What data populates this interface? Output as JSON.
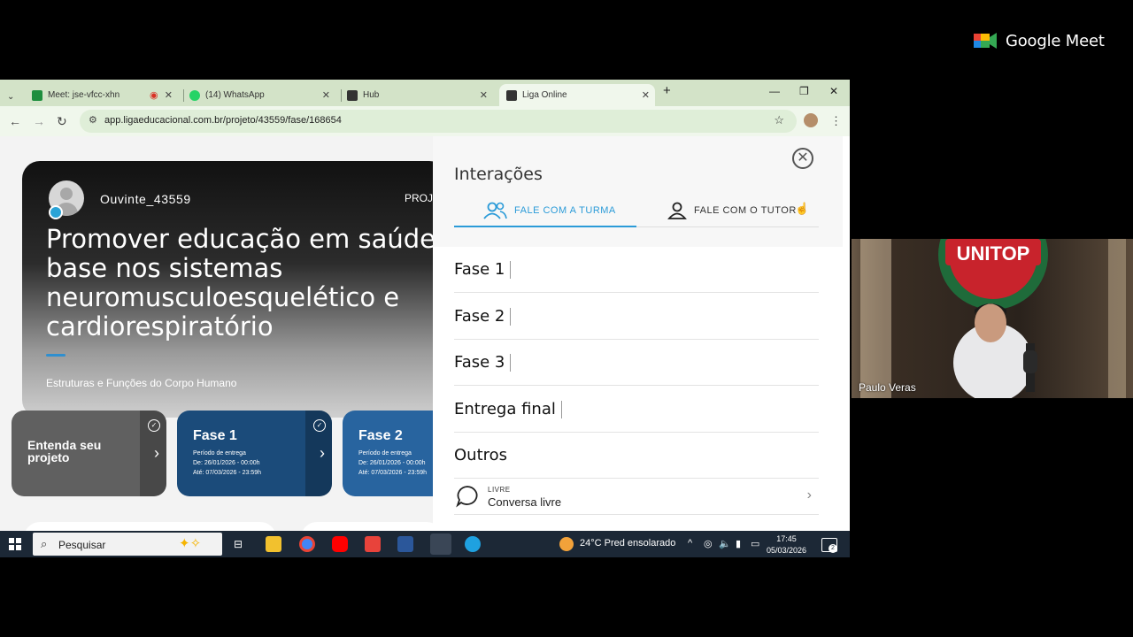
{
  "meet": {
    "brand": "Google Meet",
    "presenter_name": "Paulo Veras",
    "presenter_banner": "UNITOP"
  },
  "browser": {
    "tabs": [
      {
        "label": "Meet: jse-vfcc-xhn"
      },
      {
        "label": "(14) WhatsApp"
      },
      {
        "label": "Hub"
      },
      {
        "label": "Liga Online"
      }
    ],
    "url": "app.ligaeducacional.com.br/projeto/43559/fase/168654"
  },
  "page": {
    "user_name": "Ouvinte_43559",
    "proj_label": "PROJ",
    "title": "Promover educação em saúde base nos sistemas neuromusculoesquelético e cardiorespiratório",
    "subtitle": "Estruturas e Funções do Corpo Humano",
    "cards": {
      "intro": "Entenda seu projeto",
      "fase1": {
        "title": "Fase 1",
        "period": "Período de entrega",
        "from": "De: 26/01/2026 - 00:00h",
        "to": "Até: 07/03/2026 - 23:59h"
      },
      "fase2": {
        "title": "Fase 2",
        "period": "Período de entrega",
        "from": "De: 26/01/2026 - 00:00h",
        "to": "Até: 07/03/2026 - 23:59h"
      }
    }
  },
  "panel": {
    "title": "Interações",
    "tab_turma": "FALE COM A TURMA",
    "tab_tutor": "FALE COM O TUTOR",
    "phases": [
      "Fase 1",
      "Fase 2",
      "Fase 3",
      "Entrega final"
    ],
    "outros": "Outros",
    "livre_tag": "LIVRE",
    "livre_title": "Conversa livre"
  },
  "taskbar": {
    "search_placeholder": "Pesquisar",
    "weather": "24°C  Pred ensolarado",
    "time": "17:45",
    "date": "05/03/2026",
    "notifications": "2"
  }
}
